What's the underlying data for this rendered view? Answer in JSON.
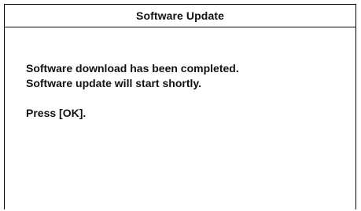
{
  "dialog": {
    "title": "Software Update",
    "message_lines": [
      "Software download has been completed.",
      "Software update will start shortly."
    ],
    "prompt": "Press [OK]."
  }
}
